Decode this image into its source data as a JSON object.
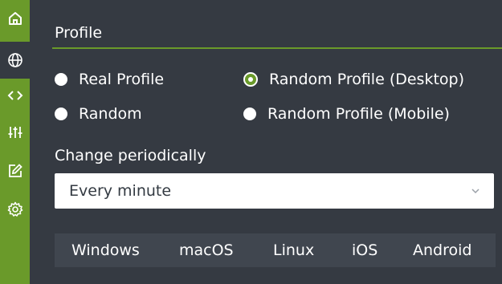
{
  "sidebar": {
    "items": [
      {
        "name": "home-icon",
        "active": false
      },
      {
        "name": "globe-icon",
        "active": true
      },
      {
        "name": "code-icon",
        "active": false
      },
      {
        "name": "sliders-icon",
        "active": false
      },
      {
        "name": "edit-icon",
        "active": false
      },
      {
        "name": "gear-icon",
        "active": false
      }
    ]
  },
  "profile": {
    "title": "Profile",
    "options": {
      "real": "Real Profile",
      "random_desktop": "Random Profile (Desktop)",
      "random": "Random",
      "random_mobile": "Random Profile (Mobile)"
    },
    "selected": "Random Profile (Desktop)"
  },
  "periodic": {
    "label": "Change periodically",
    "value": "Every minute"
  },
  "os_tabs": [
    "Windows",
    "macOS",
    "Linux",
    "iOS",
    "Android"
  ],
  "colors": {
    "accent": "#6a9a2a",
    "background": "#353a42",
    "tab_bar": "#40464f"
  }
}
